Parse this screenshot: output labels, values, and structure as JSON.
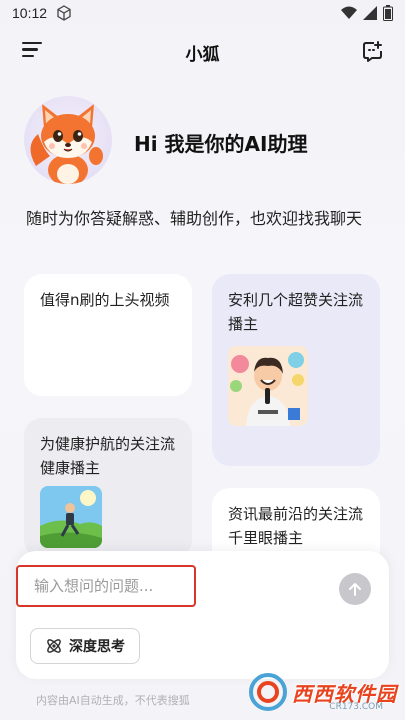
{
  "status_bar": {
    "time": "10:12"
  },
  "header": {
    "title": "小狐"
  },
  "hero": {
    "greeting": "Hi 我是你的AI助理",
    "intro": "随时为你答疑解惑、辅助创作，也欢迎找我聊天"
  },
  "cards": [
    {
      "text": "值得n刷的上头视频"
    },
    {
      "text": "安利几个超赞关注流播主"
    },
    {
      "text": "为健康护航的关注流健康播主"
    },
    {
      "text": "资讯最前沿的关注流千里眼播主"
    }
  ],
  "input": {
    "placeholder": "输入想问的问题..."
  },
  "deep_think": {
    "label": "深度思考"
  },
  "footer": {
    "disclaimer": "内容由AI自动生成，不代表搜狐"
  },
  "watermark": {
    "text": "西西软件园",
    "sub": "CR173.COM"
  },
  "colors": {
    "input_border": "#d9362b",
    "send_button": "#c7c7cc",
    "card_purple": "#e9e9f7"
  }
}
